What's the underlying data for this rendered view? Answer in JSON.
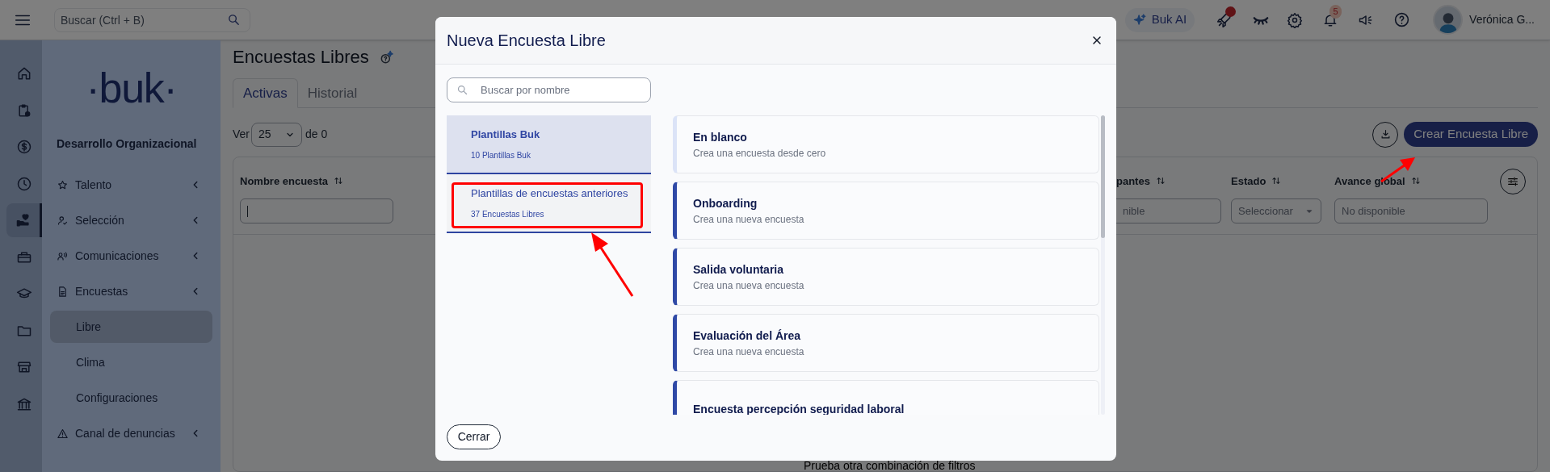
{
  "topbar": {
    "search_placeholder": "Buscar (Ctrl + B)",
    "ai_button": "Buk AI",
    "notification_count": "5",
    "user_name": "Verónica G..."
  },
  "rail": [
    {
      "selected": false
    },
    {
      "selected": false
    },
    {
      "selected": false
    },
    {
      "selected": false
    },
    {
      "selected": true
    },
    {
      "selected": false
    },
    {
      "selected": false
    },
    {
      "selected": false
    },
    {
      "selected": false
    },
    {
      "selected": false
    }
  ],
  "sidebar": {
    "logo": "·buk·",
    "section": "Desarrollo Organizacional",
    "items": [
      {
        "label": "Talento"
      },
      {
        "label": "Selección"
      },
      {
        "label": "Comunicaciones"
      },
      {
        "label": "Encuestas",
        "children": [
          {
            "label": "Libre",
            "selected": true
          },
          {
            "label": "Clima",
            "selected": false
          },
          {
            "label": "Configuraciones",
            "selected": false
          }
        ]
      },
      {
        "label": "Canal de denuncias"
      }
    ]
  },
  "page": {
    "title": "Encuestas Libres",
    "tabs": [
      {
        "label": "Activas",
        "selected": true
      },
      {
        "label": "Historial",
        "selected": false
      }
    ],
    "page_size": {
      "label": "Ver",
      "value": "25",
      "suffix": "de 0"
    },
    "create_button": "Crear Encuesta Libre",
    "columns": [
      {
        "label": "Nombre encuesta",
        "kind": "text"
      },
      {
        "label": "pantes",
        "kind": "text",
        "placeholder": "nible"
      },
      {
        "label": "Estado",
        "kind": "select",
        "placeholder": "Seleccionar"
      },
      {
        "label": "Avance global",
        "kind": "text",
        "placeholder": "No disponible"
      }
    ],
    "empty_message": "Prueba otra combinación de filtros"
  },
  "modal": {
    "title": "Nueva Encuesta Libre",
    "search_placeholder": "Buscar por nombre",
    "categories": [
      {
        "title": "Plantillas Buk",
        "count": "10 Plantillas Buk",
        "selected": true
      },
      {
        "title": "Plantillas de encuestas anteriores",
        "count": "37 Encuestas Libres",
        "selected": false
      }
    ],
    "templates": [
      {
        "kind": "blank",
        "title": "En blanco",
        "description": "Crea una encuesta desde cero"
      },
      {
        "kind": "template",
        "title": "Onboarding",
        "description": "Crea una nueva encuesta"
      },
      {
        "kind": "template",
        "title": "Salida voluntaria",
        "description": "Crea una nueva encuesta"
      },
      {
        "kind": "template",
        "title": "Evaluación del Área",
        "description": "Crea una nueva encuesta"
      },
      {
        "kind": "template",
        "title": "Encuesta percepción seguridad laboral"
      }
    ],
    "close_button": "Cerrar"
  }
}
